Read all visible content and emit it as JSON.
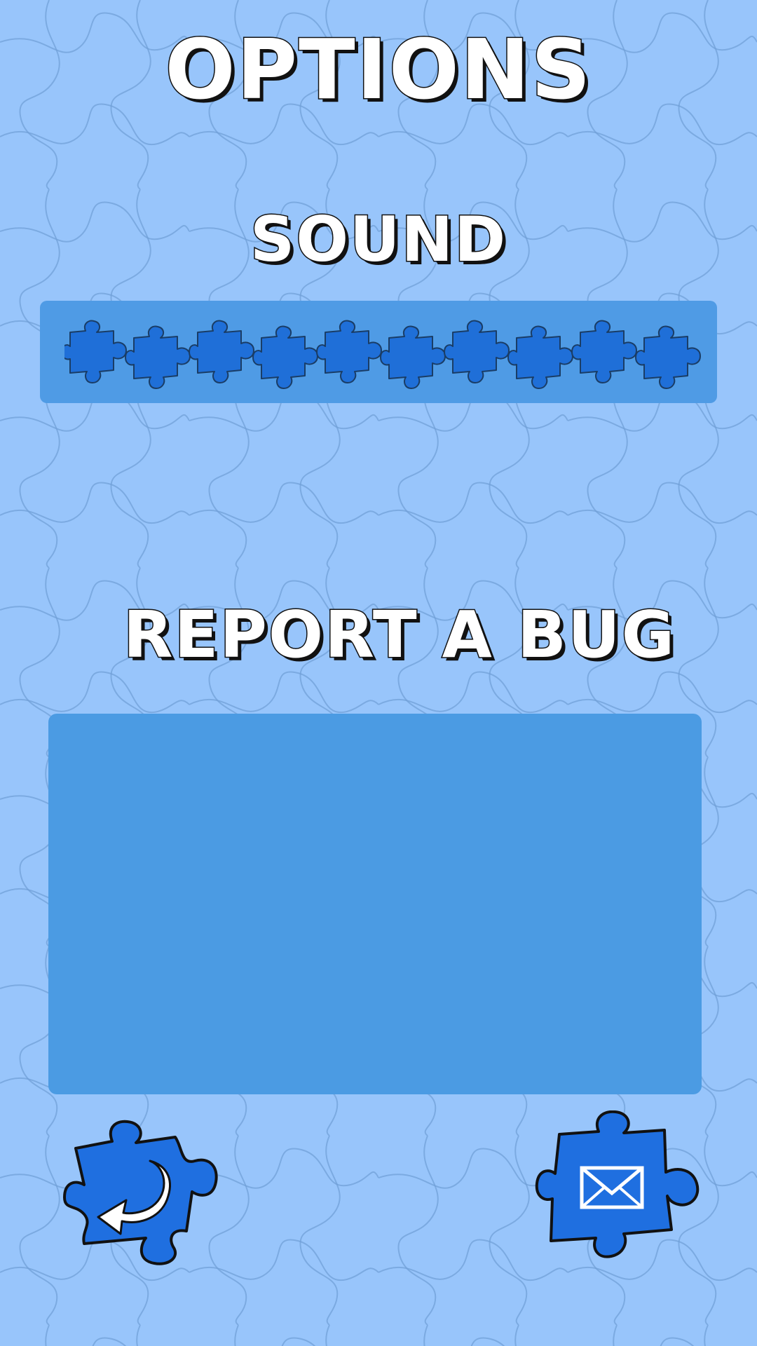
{
  "screen": {
    "title": "OPTIONS",
    "background_color": "#98c5fb",
    "accent_color": "#1f6fe0"
  },
  "sound": {
    "label": "SOUND",
    "level": 1.0,
    "segments": 10,
    "panel_color": "#4f9be5",
    "segment_color": "#1f6fd8"
  },
  "report": {
    "label": "REPORT A  BUG",
    "message_value": "",
    "panel_color": "#4b9be3"
  },
  "buttons": {
    "back_icon": "back-arrow-icon",
    "send_icon": "envelope-icon",
    "button_color": "#1f6fe0"
  }
}
